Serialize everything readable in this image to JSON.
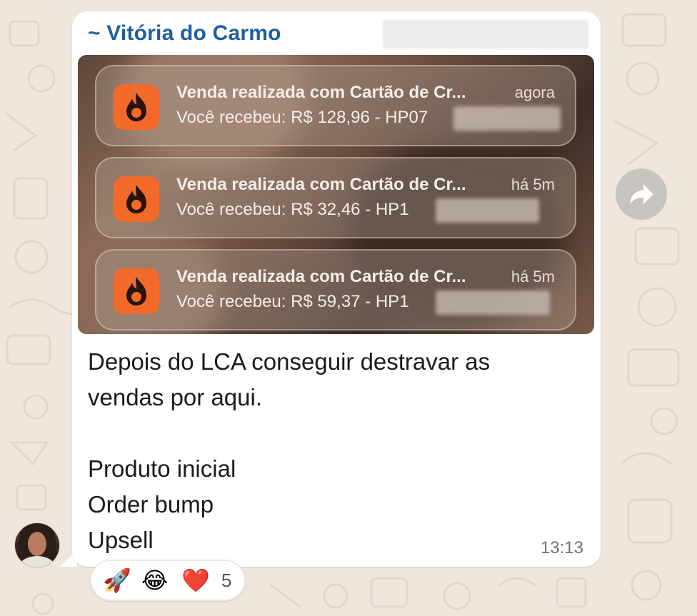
{
  "chat": {
    "sender_name": "~ Vitória do Carmo"
  },
  "notifications": [
    {
      "title": "Venda realizada com Cartão de Cr...",
      "time": "agora",
      "body": "Você recebeu: R$ 128,96 - HP07"
    },
    {
      "title": "Venda realizada com Cartão de Cr...",
      "time": "há 5m",
      "body": "Você recebeu: R$ 32,46 - HP1"
    },
    {
      "title": "Venda realizada com Cartão de Cr...",
      "time": "há 5m",
      "body": "Você recebeu: R$ 59,37 - HP1"
    }
  ],
  "message": {
    "line1": "Depois do LCA conseguir destravar as",
    "line2": "vendas por aqui.",
    "line3": "Produto inicial",
    "line4": "Order bump",
    "line5": "Upsell",
    "time": "13:13"
  },
  "reactions": {
    "emojis": [
      "🚀",
      "😂",
      "❤️"
    ],
    "count": "5"
  },
  "colors": {
    "sender": "#1f5fa0",
    "notif_icon": "#f26a2a",
    "bubble": "#ffffff",
    "wallpaper": "#efe7dd"
  },
  "icons": {
    "notification_app": "flame-icon",
    "forward": "forward-arrow-icon"
  }
}
